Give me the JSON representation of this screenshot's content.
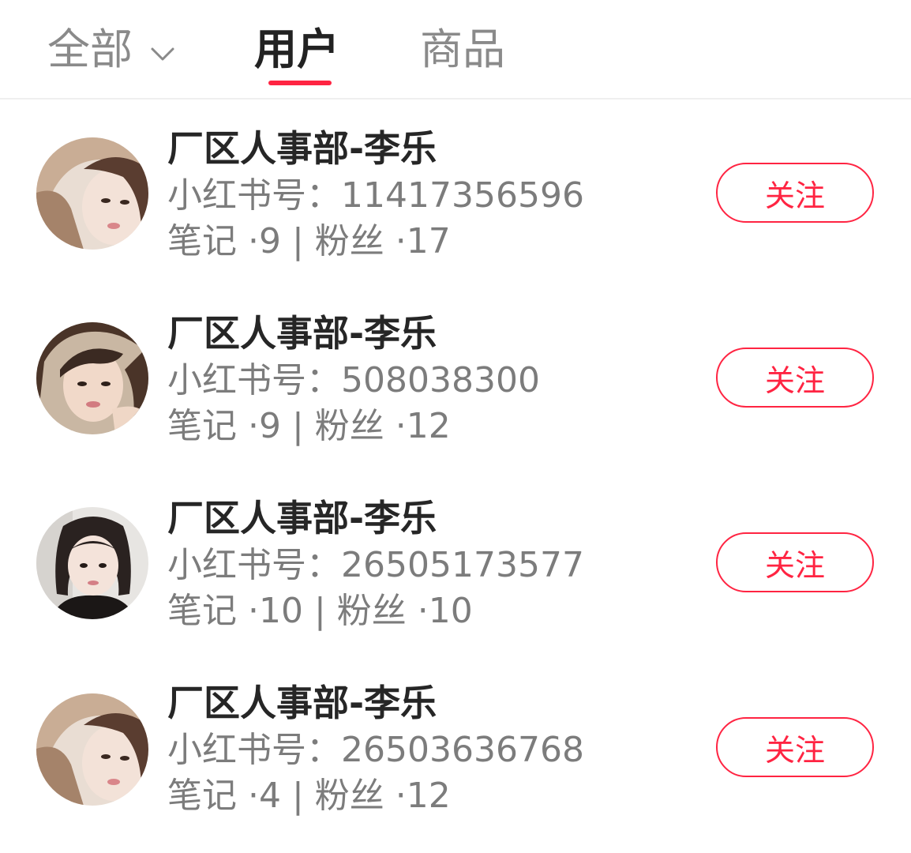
{
  "tabs": {
    "all": "全部",
    "users": "用户",
    "products": "商品"
  },
  "colors": {
    "accent": "#ff2442",
    "text_primary": "#262626",
    "text_secondary": "#7c7c7c"
  },
  "users": [
    {
      "name": "厂区人事部-李乐",
      "id_line": "小红书号：11417356596",
      "stats_line": "笔记 ·9 | 粉丝 ·17",
      "follow_label": "关注",
      "avatar": "avatar-photo"
    },
    {
      "name": "厂区人事部-李乐",
      "id_line": "小红书号：508038300",
      "stats_line": "笔记 ·9 | 粉丝 ·12",
      "follow_label": "关注",
      "avatar": "avatar-photo"
    },
    {
      "name": "厂区人事部-李乐",
      "id_line": "小红书号：26505173577",
      "stats_line": "笔记 ·10 | 粉丝 ·10",
      "follow_label": "关注",
      "avatar": "avatar-photo"
    },
    {
      "name": "厂区人事部-李乐",
      "id_line": "小红书号：26503636768",
      "stats_line": "笔记 ·4 | 粉丝 ·12",
      "follow_label": "关注",
      "avatar": "avatar-photo"
    }
  ]
}
